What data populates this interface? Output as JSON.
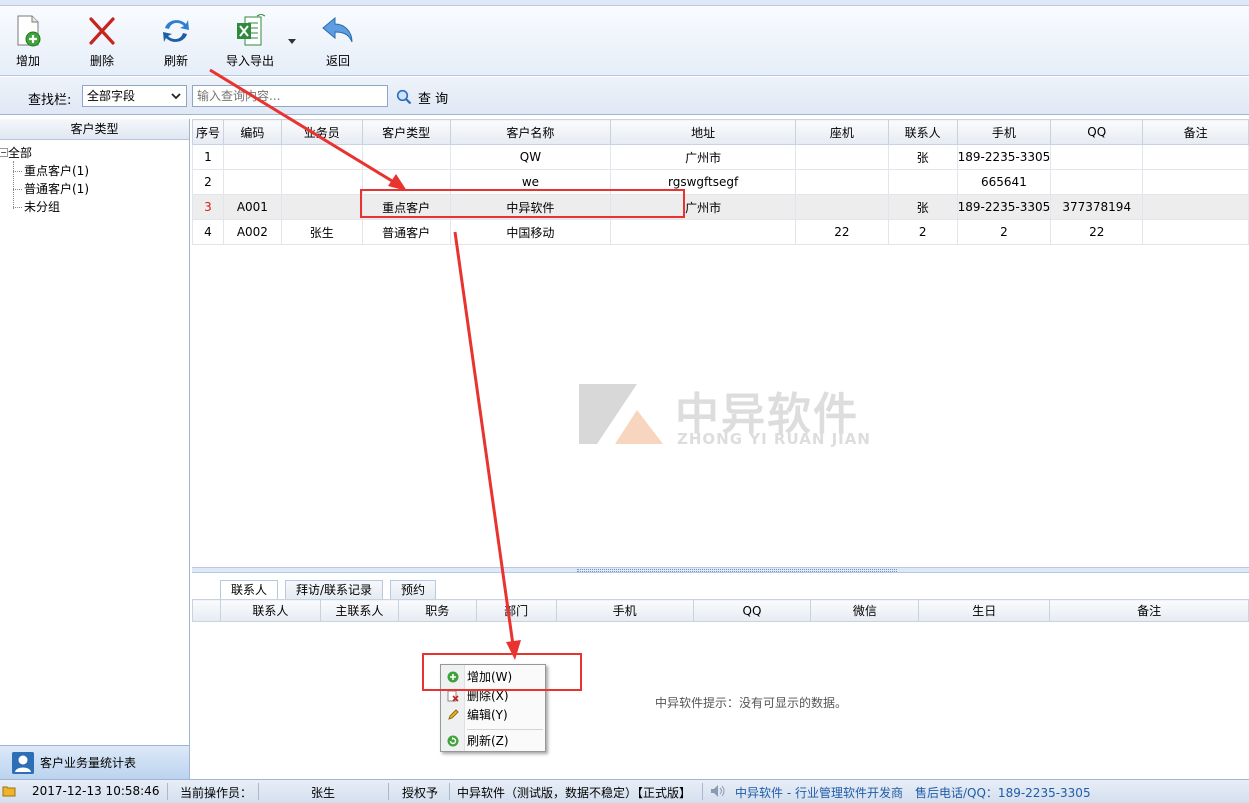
{
  "toolbar": {
    "add_label": "增加",
    "delete_label": "删除",
    "refresh_label": "刷新",
    "import_export_label": "导入导出",
    "back_label": "返回"
  },
  "search": {
    "label": "查找栏:",
    "field_value": "全部字段",
    "placeholder": "输入查询内容...",
    "button_label": "查 询"
  },
  "tree": {
    "header": "客户类型",
    "root": "全部",
    "children": [
      "重点客户(1)",
      "普通客户(1)",
      "未分组"
    ]
  },
  "left_bottom": {
    "label": "客户业务量统计表"
  },
  "grid": {
    "columns": [
      "序号",
      "编码",
      "业务员",
      "客户类型",
      "客户名称",
      "地址",
      "座机",
      "联系人",
      "手机",
      "QQ",
      "备注"
    ],
    "rows": [
      [
        "1",
        "",
        "",
        "",
        "QW",
        "广州市",
        "",
        "张",
        "189-2235-3305",
        "",
        ""
      ],
      [
        "2",
        "",
        "",
        "",
        "we",
        "rgswgftsegf",
        "",
        "",
        "665641",
        "",
        ""
      ],
      [
        "3",
        "A001",
        "",
        "重点客户",
        "中异软件",
        "广州市",
        "",
        "张",
        "189-2235-3305",
        "377378194",
        ""
      ],
      [
        "4",
        "A002",
        "张生",
        "普通客户",
        "中国移动",
        "",
        "22",
        "2",
        "2",
        "22",
        ""
      ]
    ],
    "selected_row": 2
  },
  "watermark": {
    "cn": "中异软件",
    "en": "ZHONG YI RUAN JIAN"
  },
  "detail": {
    "tabs": [
      "联系人",
      "拜访/联系记录",
      "预约"
    ],
    "columns": [
      "",
      "联系人",
      "主联系人",
      "职务",
      "部门",
      "手机",
      "QQ",
      "微信",
      "生日",
      "备注"
    ],
    "empty_message": "中异软件提示：没有可显示的数据。"
  },
  "context_menu": {
    "items": [
      "增加(W)",
      "删除(X)",
      "编辑(Y)",
      "刷新(Z)"
    ]
  },
  "statusbar": {
    "datetime": "2017-12-13 10:58:46",
    "operator_label": "当前操作员：",
    "operator": "张生",
    "license_label": "授权予",
    "license_value": "中异软件（测试版，数据不稳定）【正式版】",
    "company": "中异软件 - 行业管理软件开发商",
    "support": "售后电话/QQ：189-2235-3305"
  },
  "colors": {
    "accent_blue": "#1f5ca8",
    "annotation_red": "#e8332e",
    "selected_index_red": "#d21d1d"
  }
}
